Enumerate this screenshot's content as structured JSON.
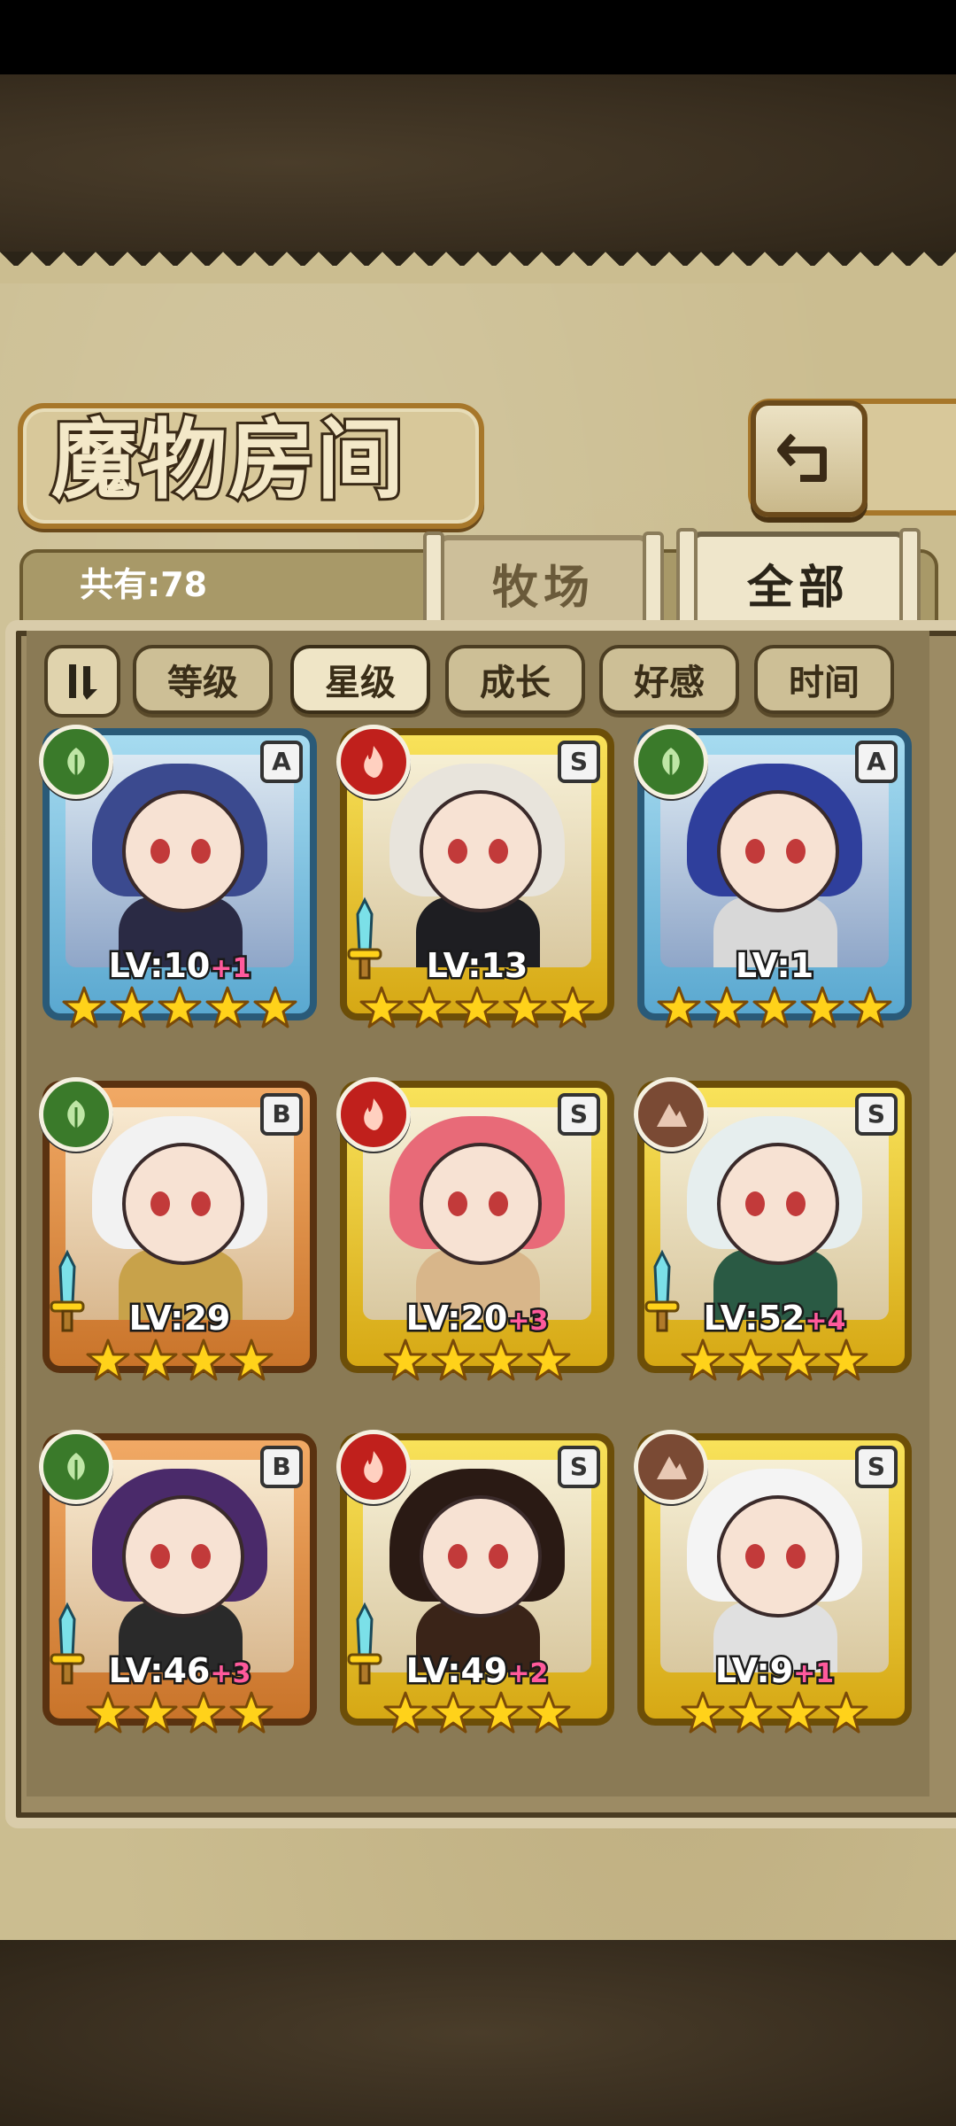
{
  "title": "魔物房间",
  "count_label": "共有:78",
  "tabs": {
    "ranch": "牧场",
    "all": "全部"
  },
  "sort_buttons": [
    "等级",
    "星级",
    "成长",
    "好感",
    "时间"
  ],
  "active_sort": "星级",
  "colors": {
    "leaf": "#3a7a2a",
    "fire": "#c0201c",
    "earth": "#7a4a34",
    "rank_A": "#5aa8d0",
    "rank_S": "#d6a814",
    "rank_B": "#c9742a",
    "plus_text": "#ff5a9c"
  },
  "monsters": [
    {
      "rank": "A",
      "element": "leaf-icon",
      "level": "LV:10",
      "plus": "+1",
      "stars": 5,
      "sword": false,
      "hair": "#3b4a8f",
      "body": "#2a2a44"
    },
    {
      "rank": "S",
      "element": "fire-icon",
      "level": "LV:13",
      "plus": "",
      "stars": 5,
      "sword": true,
      "hair": "#e8e4dc",
      "body": "#1e1e22"
    },
    {
      "rank": "A",
      "element": "leaf-icon",
      "level": "LV:1",
      "plus": "",
      "stars": 5,
      "sword": false,
      "hair": "#2f3f9c",
      "body": "#d8d8d8"
    },
    {
      "rank": "B",
      "element": "leaf-icon",
      "level": "LV:29",
      "plus": "",
      "stars": 4,
      "sword": true,
      "hair": "#f2f2f2",
      "body": "#c8a24a"
    },
    {
      "rank": "S",
      "element": "fire-icon",
      "level": "LV:20",
      "plus": "+3",
      "stars": 4,
      "sword": false,
      "hair": "#e86a78",
      "body": "#d8b68a"
    },
    {
      "rank": "S",
      "element": "earth-icon",
      "level": "LV:52",
      "plus": "+4",
      "stars": 4,
      "sword": true,
      "hair": "#e6eeee",
      "body": "#2a5a44"
    },
    {
      "rank": "B",
      "element": "leaf-icon",
      "level": "LV:46",
      "plus": "+3",
      "stars": 4,
      "sword": true,
      "hair": "#4a2a6a",
      "body": "#2a2a2a"
    },
    {
      "rank": "S",
      "element": "fire-icon",
      "level": "LV:49",
      "plus": "+2",
      "stars": 4,
      "sword": true,
      "hair": "#2a1a14",
      "body": "#3a2418"
    },
    {
      "rank": "S",
      "element": "earth-icon",
      "level": "LV:9",
      "plus": "+1",
      "stars": 4,
      "sword": false,
      "hair": "#f4f4f4",
      "body": "#e0e0e0"
    }
  ]
}
